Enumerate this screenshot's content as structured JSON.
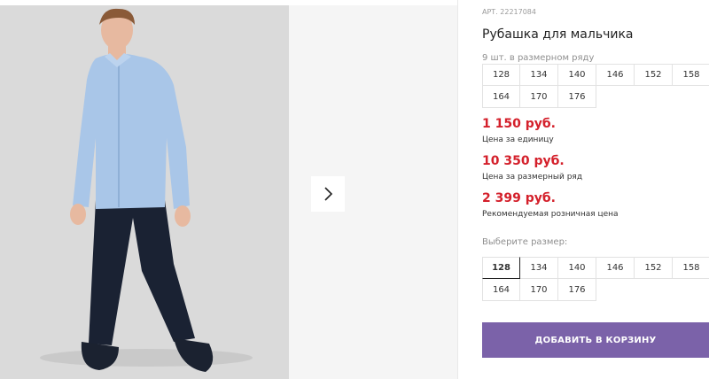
{
  "gallery": {
    "next_icon": "chevron-right-icon"
  },
  "product": {
    "art_label": "АРТ. 22217084",
    "title": "Рубашка для мальчика",
    "pack_note": "9 шт. в размерном ряду",
    "pack_sizes": [
      "128",
      "134",
      "140",
      "146",
      "152",
      "158",
      "164",
      "170",
      "176"
    ]
  },
  "prices": [
    {
      "value": "1 150 руб.",
      "label": "Цена за единицу"
    },
    {
      "value": "10 350 руб.",
      "label": "Цена за размерный ряд"
    },
    {
      "value": "2 399 руб.",
      "label": "Рекомендуемая розничная цена"
    }
  ],
  "size_select": {
    "label": "Выберите размер:",
    "selected": "128",
    "sizes": [
      "128",
      "134",
      "140",
      "146",
      "152",
      "158",
      "164",
      "170",
      "176"
    ]
  },
  "cart_button": {
    "label": "ДОБАВИТЬ В КОРЗИНУ"
  },
  "colors": {
    "price": "#d4202b",
    "button": "#7b62a9"
  }
}
